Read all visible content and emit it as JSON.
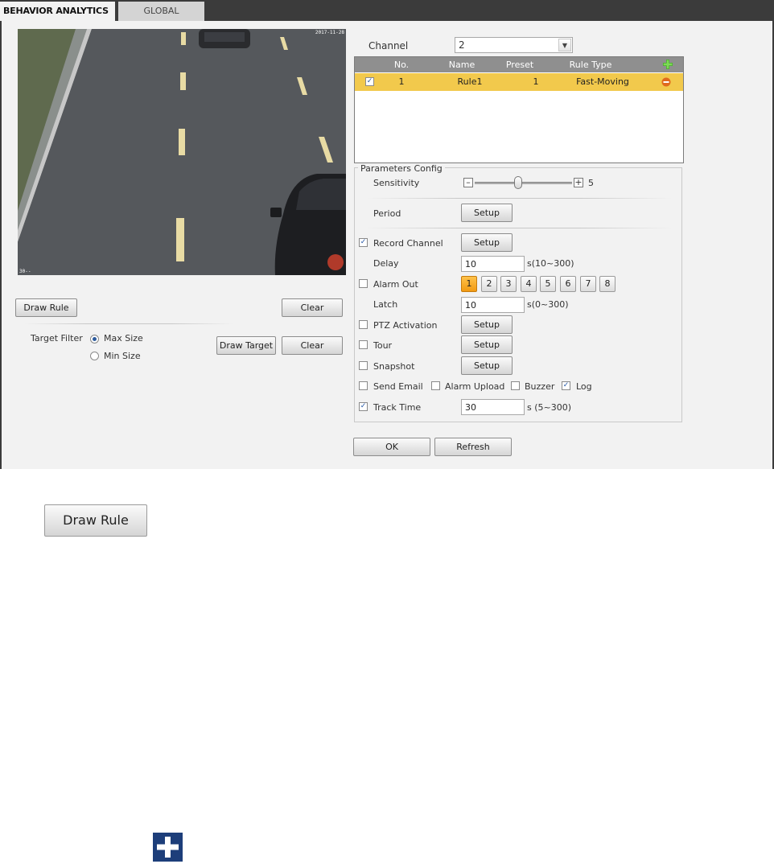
{
  "tabs": [
    {
      "label": "BEHAVIOR ANALYTICS",
      "active": true
    },
    {
      "label": "GLOBAL",
      "active": false
    }
  ],
  "video": {
    "osd_top": "2017-11-28",
    "osd_bottom": "30--"
  },
  "left_controls": {
    "draw_rule": "Draw Rule",
    "clear": "Clear",
    "target_filter_label": "Target Filter",
    "max_size": "Max Size",
    "min_size": "Min Size",
    "draw_target": "Draw Target",
    "clear2": "Clear",
    "selected_filter": "Max Size"
  },
  "channel": {
    "label": "Channel",
    "value": "2"
  },
  "rule_table": {
    "headers": [
      "No.",
      "Name",
      "Preset",
      "Rule Type"
    ],
    "rows": [
      {
        "checked": true,
        "no": "1",
        "name": "Rule1",
        "preset": "1",
        "type": "Fast-Moving"
      }
    ]
  },
  "params": {
    "title": "Parameters Config",
    "sensitivity_label": "Sensitivity",
    "sensitivity_value": "5",
    "sensitivity_level": 5,
    "period_label": "Period",
    "record_channel_label": "Record Channel",
    "delay_label": "Delay",
    "delay_value": "10",
    "delay_range": "s(10~300)",
    "alarm_out_label": "Alarm Out",
    "alarm_outs": [
      "1",
      "2",
      "3",
      "4",
      "5",
      "6",
      "7",
      "8"
    ],
    "alarm_out_active": "1",
    "latch_label": "Latch",
    "latch_value": "10",
    "latch_range": "s(0~300)",
    "ptz_label": "PTZ Activation",
    "tour_label": "Tour",
    "snapshot_label": "Snapshot",
    "send_email_label": "Send Email",
    "alarm_upload_label": "Alarm Upload",
    "buzzer_label": "Buzzer",
    "log_label": "Log",
    "track_time_label": "Track Time",
    "track_time_value": "30",
    "track_time_range": "s (5~300)",
    "setup": "Setup",
    "checks": {
      "record_channel": true,
      "alarm_out": false,
      "ptz": false,
      "tour": false,
      "snapshot": false,
      "send_email": false,
      "alarm_upload": false,
      "buzzer": false,
      "log": true,
      "track_time": true
    }
  },
  "footer": {
    "ok": "OK",
    "refresh": "Refresh"
  },
  "below": {
    "draw_rule_large": "Draw Rule"
  },
  "colors": {
    "accent": "#f2c94c",
    "header_bar": "#3b3b3b",
    "active_alarm": "#f29a12",
    "add_icon": "#4caf2f",
    "delete_icon": "#e06a1d",
    "plus_tile": "#1d3e7a"
  }
}
